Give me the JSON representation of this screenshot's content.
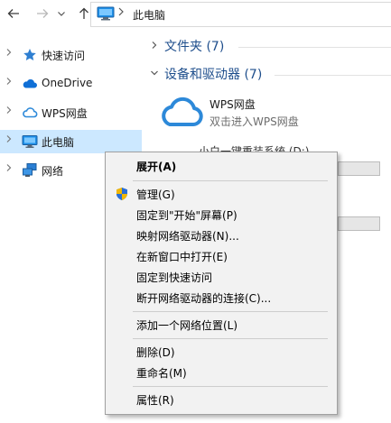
{
  "toolbar": {
    "back_icon": "arrow-left-icon",
    "forward_icon": "arrow-right-icon",
    "dropdown_icon": "chevron-down-icon",
    "up_icon": "arrow-up-icon",
    "address": {
      "location_icon": "this-pc-icon",
      "path": "此电脑"
    }
  },
  "sidebar": {
    "items": [
      {
        "label": "快速访问",
        "icon": "star-icon",
        "selected": false
      },
      {
        "label": "OneDrive",
        "icon": "cloud-icon",
        "selected": false
      },
      {
        "label": "WPS网盘",
        "icon": "wps-cloud-icon",
        "selected": false
      },
      {
        "label": "此电脑",
        "icon": "computer-icon",
        "selected": true
      },
      {
        "label": "网络",
        "icon": "network-icon",
        "selected": false
      }
    ]
  },
  "content": {
    "folders_group": {
      "title": "文件夹 (7)",
      "expanded": false
    },
    "devices_group": {
      "title": "设备和驱动器 (7)",
      "expanded": true
    },
    "wps_drive": {
      "name": "WPS网盘",
      "subtitle": "双击进入WPS网盘"
    },
    "partial_drive_label": "小白一键重装系统 (D:)"
  },
  "context_menu": {
    "items": [
      {
        "label": "展开(A)",
        "bold": true
      },
      {
        "separator": true
      },
      {
        "label": "管理(G)",
        "icon": "shield-icon"
      },
      {
        "label": "固定到\"开始\"屏幕(P)"
      },
      {
        "label": "映射网络驱动器(N)..."
      },
      {
        "label": "在新窗口中打开(E)"
      },
      {
        "label": "固定到快速访问"
      },
      {
        "label": "断开网络驱动器的连接(C)..."
      },
      {
        "separator": true
      },
      {
        "label": "添加一个网络位置(L)"
      },
      {
        "separator": true
      },
      {
        "label": "删除(D)"
      },
      {
        "label": "重命名(M)"
      },
      {
        "separator": true
      },
      {
        "label": "属性(R)"
      }
    ]
  },
  "colors": {
    "selection": "#cce8ff",
    "group_title": "#1e4e8c",
    "cloud_blue": "#2d89d9",
    "menu_bg": "#f2f2f2"
  }
}
